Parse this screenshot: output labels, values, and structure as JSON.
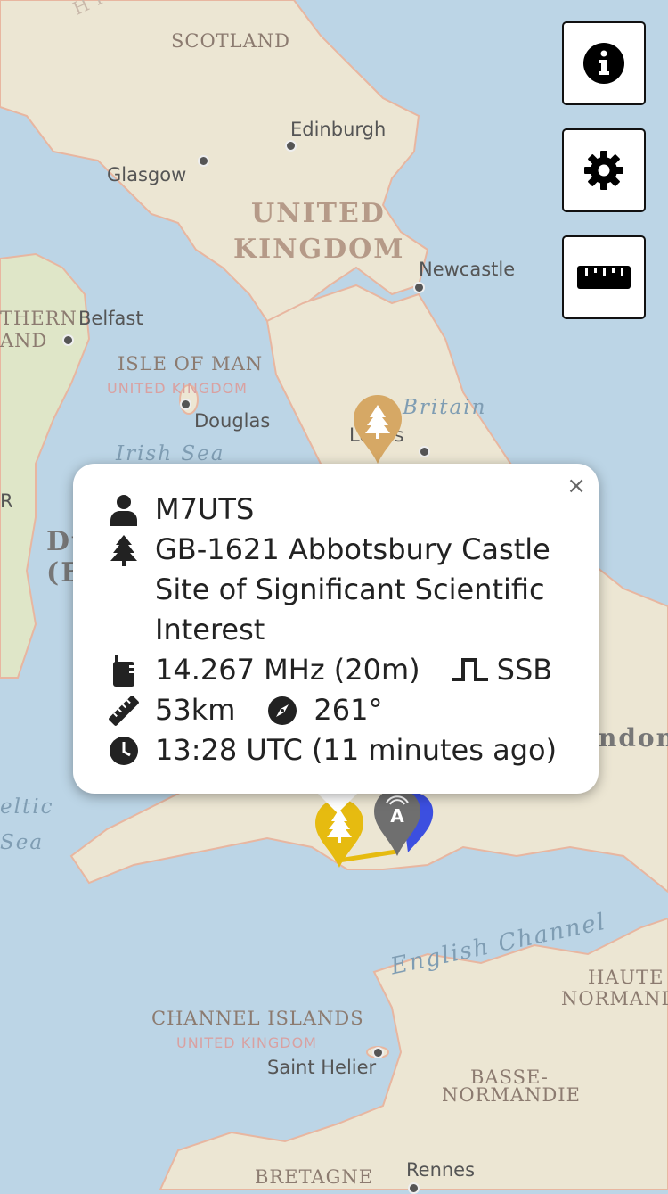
{
  "map": {
    "labels": {
      "scotland": "SCOTLAND",
      "united": "UNITED",
      "kingdom": "KINGDOM",
      "edinburgh": "Edinburgh",
      "glasgow": "Glasgow",
      "newcastle": "Newcastle",
      "belfast": "Belfast",
      "northern1": "THERN",
      "northern2": "AND",
      "isle_of_man": "ISLE OF MAN",
      "isle_of_man_uk": "UNITED KINGDOM",
      "douglas": "Douglas",
      "britain": "Britain",
      "leeds": "Leeds",
      "irish_sea": "Irish Sea",
      "dublin1": "Du",
      "dublin2": "(B",
      "r_edge": "R",
      "london_part": "ndon",
      "celtic1": "eltic",
      "celtic2": "Sea",
      "english_channel": "English Channel",
      "haute": "HAUTE",
      "normandie": "NORMANDIE",
      "channel_islands": "CHANNEL ISLANDS",
      "channel_islands_uk": "UNITED KINGDOM",
      "saint_helier": "Saint Helier",
      "basse": "BASSE-",
      "basse_normandie": "NORMANDIE",
      "bretagne": "BRETAGNE",
      "rennes": "Rennes",
      "highlands_partial": "H I G H"
    },
    "colors": {
      "water": "#bcd5e6",
      "land": "#ece6d3",
      "green_land": "#dfe6c8",
      "marker_park": "#d6a865",
      "marker_spot": "#e6bb10",
      "marker_station": "#6f6f6f",
      "marker_home": "#3c4fe0"
    }
  },
  "controls": [
    {
      "name": "info",
      "icon": "info-icon"
    },
    {
      "name": "settings",
      "icon": "gear-icon"
    },
    {
      "name": "ruler",
      "icon": "ruler-icon"
    }
  ],
  "popup": {
    "close_label": "×",
    "callsign": "M7UTS",
    "park": "GB-1621 Abbotsbury Castle Site of Significant Scientific Interest",
    "frequency": "14.267 MHz (20m)",
    "mode": "SSB",
    "distance": "53km",
    "bearing": "261°",
    "time": "13:28 UTC (11 minutes ago)",
    "icons": [
      "user-icon",
      "tree-icon",
      "radio-icon",
      "mode-icon",
      "ruler-icon",
      "compass-icon",
      "clock-icon"
    ]
  }
}
